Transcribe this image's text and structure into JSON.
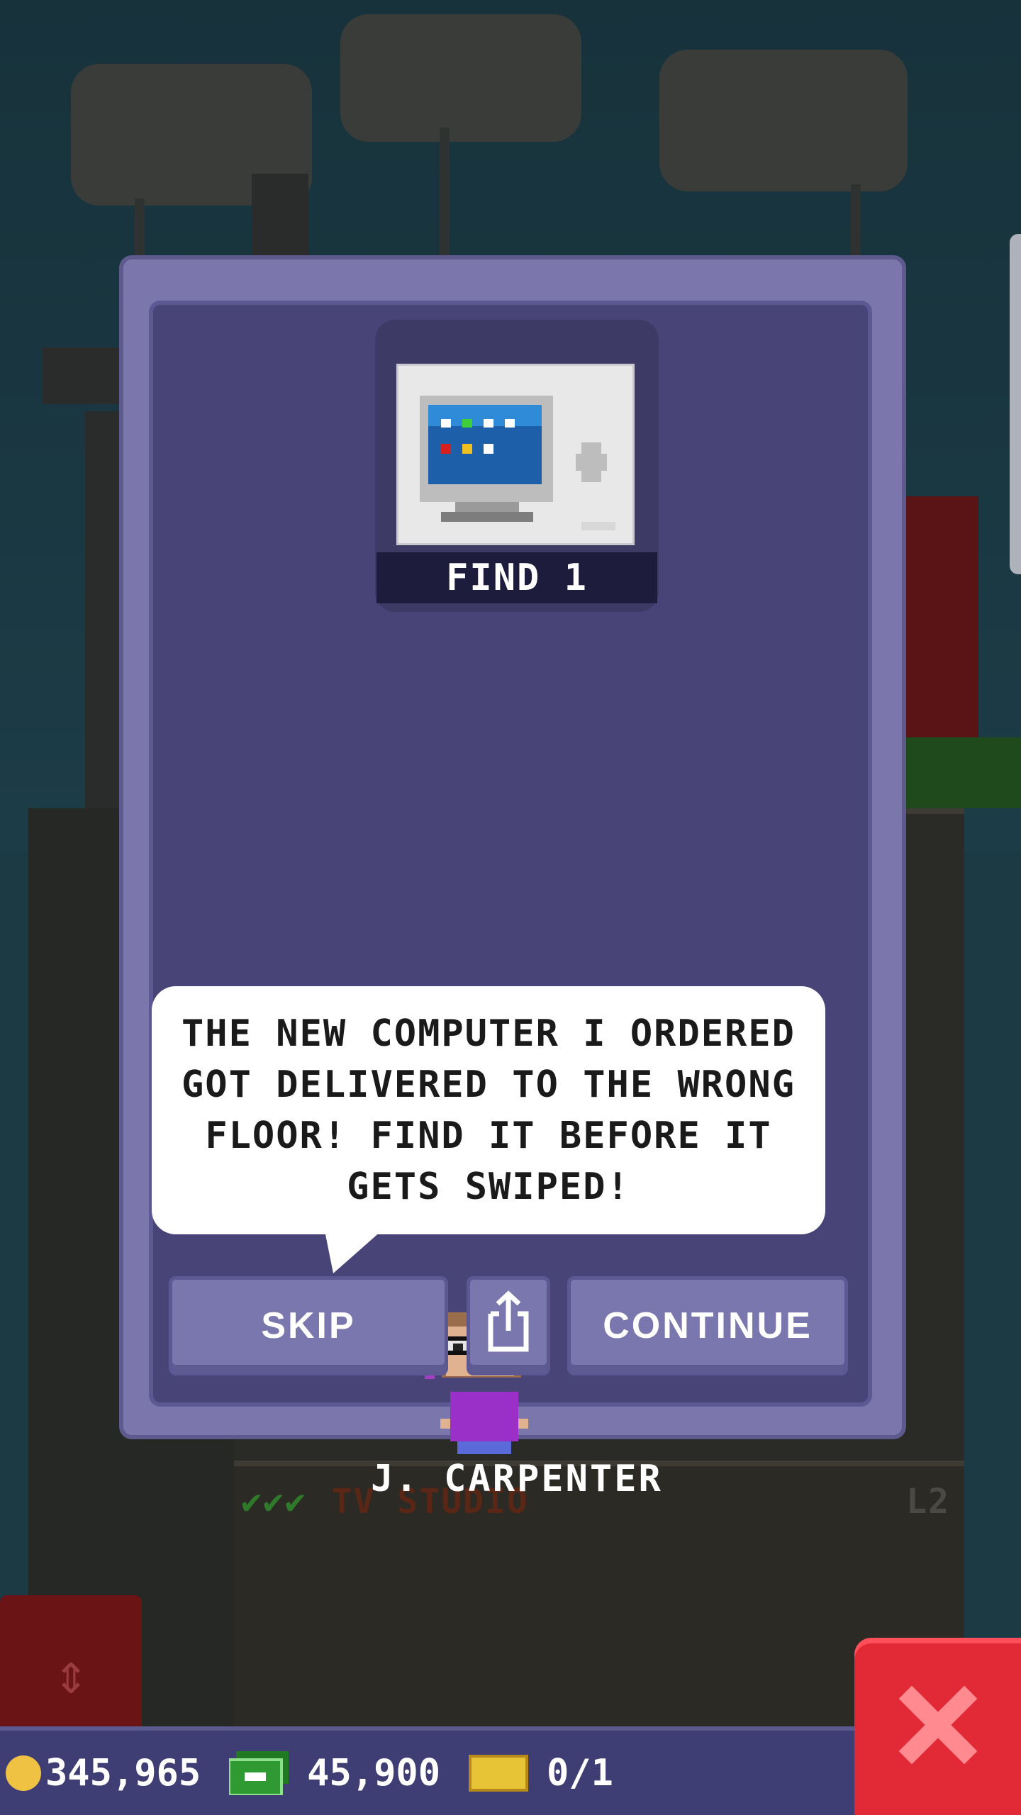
{
  "mission": {
    "find_label": "FIND 1",
    "item_icon": "computer-icon"
  },
  "dialog": {
    "message": "THE NEW COMPUTER I ORDERED GOT DELIVERED TO THE WRONG FLOOR! FIND IT BEFORE IT GETS SWIPED!",
    "character_name": "J. CARPENTER"
  },
  "buttons": {
    "skip": "SKIP",
    "share_icon": "share-icon",
    "continue": "CONTINUE"
  },
  "background": {
    "floor_name": "TV STUDIO",
    "floor_level": "L2",
    "floor_checks": "✔✔✔"
  },
  "status": {
    "coins": "345,965",
    "bux_cash": "45,900",
    "golden_tickets": "0/1"
  },
  "colors": {
    "card": "#7b77ad",
    "card_inner": "#484478",
    "close_button": "#e22a36",
    "coin": "#f0c244",
    "cash": "#2f9a32"
  }
}
